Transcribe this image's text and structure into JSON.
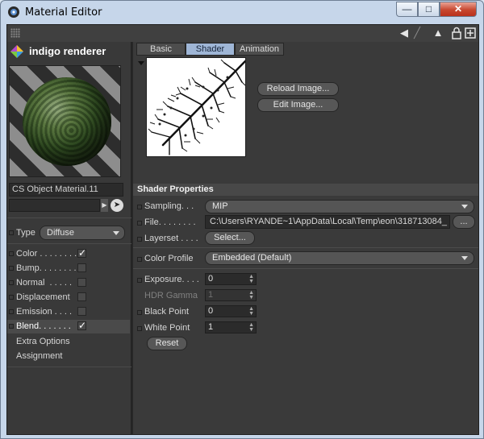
{
  "window": {
    "title": "Material Editor",
    "minimize_glyph": "—",
    "maximize_glyph": "□",
    "close_glyph": "✕"
  },
  "toolbar": {
    "icons": [
      "back-arrow-icon",
      "forward-arrow-icon",
      "pointer-icon",
      "lock-icon",
      "new-window-icon"
    ]
  },
  "brand": {
    "name": "indigo renderer"
  },
  "material": {
    "name": "CS Object Material.11",
    "type_label": "Type",
    "type_value": "Diffuse"
  },
  "channels": [
    {
      "label": "Color . . . . . . . .",
      "checked": true,
      "active": false
    },
    {
      "label": "Bump. . . . . . . .",
      "checked": false,
      "active": false
    },
    {
      "label": "Normal  . . . . .",
      "checked": false,
      "active": false
    },
    {
      "label": "Displacement",
      "checked": false,
      "active": false
    },
    {
      "label": "Emission . . . .",
      "checked": false,
      "active": false
    },
    {
      "label": "Blend. . . . . . .",
      "checked": true,
      "active": true
    }
  ],
  "channel_marks": {
    "checked": "✓",
    "unchecked": ""
  },
  "extra": {
    "options": "Extra Options",
    "assignment": "Assignment"
  },
  "tabs": [
    {
      "label": "Basic",
      "active": false
    },
    {
      "label": "Shader",
      "active": true
    },
    {
      "label": "Animation",
      "active": false
    }
  ],
  "image_buttons": {
    "reload": "Reload Image...",
    "edit": "Edit Image..."
  },
  "shader": {
    "section_title": "Shader Properties",
    "sampling_label": "Sampling. . .",
    "sampling_value": "MIP",
    "file_label": "File. . . . . . . .",
    "file_value": "C:\\Users\\RYANDE~1\\AppData\\Local\\Temp\\eon\\318713084_",
    "browse_label": "...",
    "layerset_label": "Layerset . . . .",
    "layerset_button": "Select...",
    "color_profile_label": "Color Profile",
    "color_profile_value": "Embedded (Default)",
    "exposure_label": "Exposure. . . .",
    "exposure_value": "0",
    "hdr_gamma_label": "HDR Gamma",
    "hdr_gamma_value": "1",
    "black_point_label": "Black Point",
    "black_point_value": "0",
    "white_point_label": "White Point",
    "white_point_value": "1",
    "reset_label": "Reset"
  },
  "colors": {
    "accent_tab": "#9fb6d6",
    "panel_bg": "#3a3a3a",
    "close_red": "#c7472f"
  }
}
